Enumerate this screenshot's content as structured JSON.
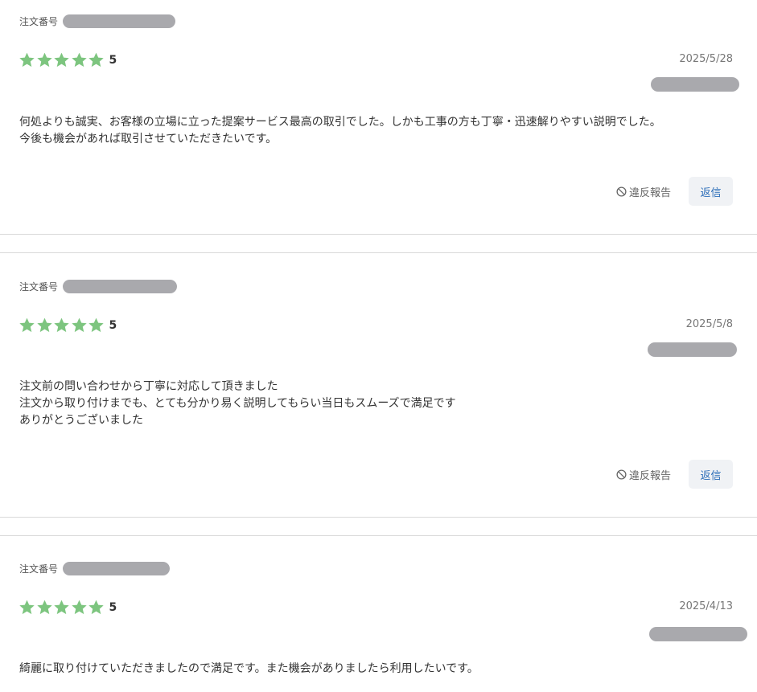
{
  "labels": {
    "order_number": "注文番号",
    "report": "違反報告",
    "reply": "返信"
  },
  "colors": {
    "star": "#7dc57f",
    "reply_text": "#2a6cb8",
    "redaction": "#a9a9ad"
  },
  "reviews": [
    {
      "rating": 5,
      "rating_label": "5",
      "date": "2025/5/28",
      "lines": [
        "何処よりも誠実、お客様の立場に立った提案サービス最高の取引でした。しかも工事の方も丁寧・迅速解りやすい説明でした。",
        "今後も機会があれば取引させていただきたいです。"
      ]
    },
    {
      "rating": 5,
      "rating_label": "5",
      "date": "2025/5/8",
      "lines": [
        "注文前の問い合わせから丁寧に対応して頂きました",
        "注文から取り付けまでも、とても分かり易く説明してもらい当日もスムーズで満足です",
        "ありがとうございました"
      ]
    },
    {
      "rating": 5,
      "rating_label": "5",
      "date": "2025/4/13",
      "lines": [
        "綺麗に取り付けていただきましたので満足です。また機会がありましたら利用したいです。"
      ]
    }
  ]
}
